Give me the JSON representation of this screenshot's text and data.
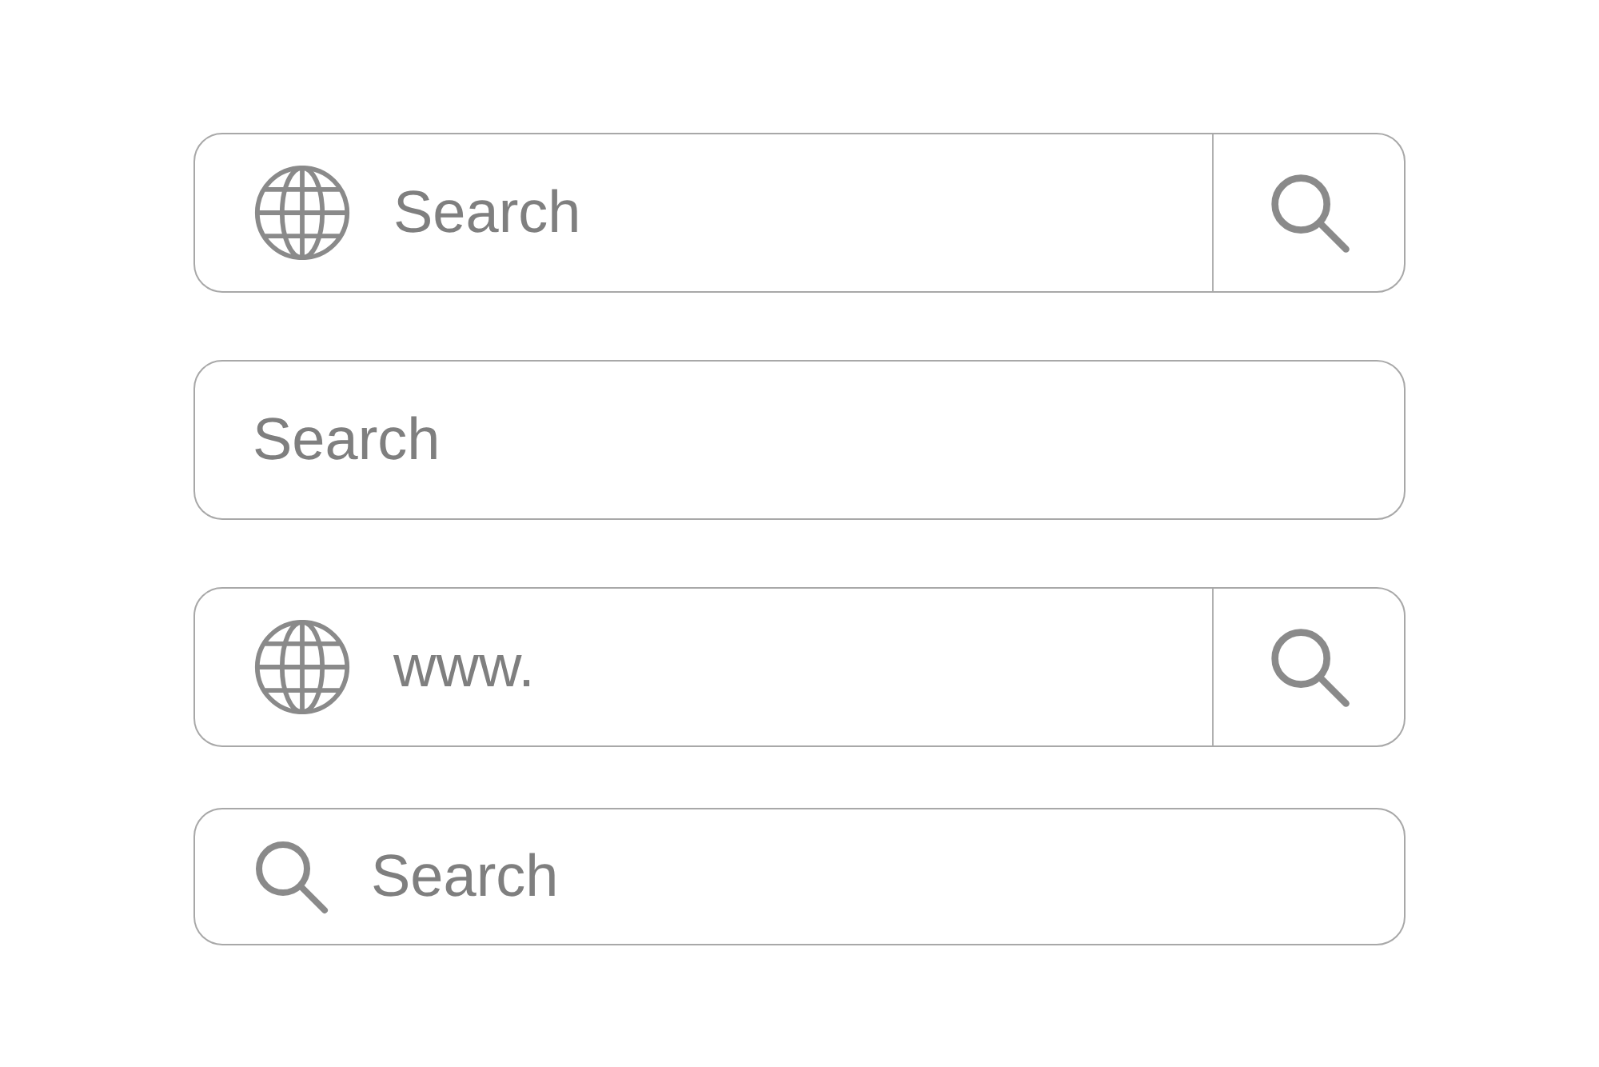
{
  "search_bars": [
    {
      "kind": "globe-button",
      "placeholder": "Search"
    },
    {
      "kind": "plain",
      "placeholder": "Search"
    },
    {
      "kind": "globe-button",
      "placeholder": "www."
    },
    {
      "kind": "search-lead",
      "placeholder": "Search"
    }
  ]
}
